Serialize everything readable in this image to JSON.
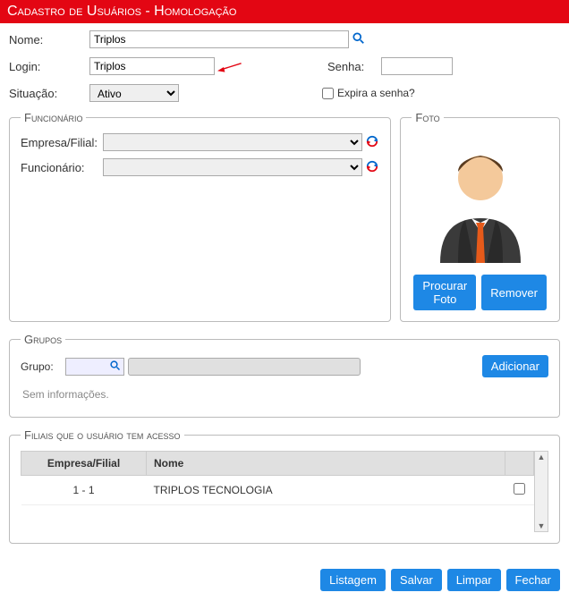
{
  "header": {
    "title": "Cadastro de Usuários  - Homologação"
  },
  "form": {
    "nome_label": "Nome:",
    "nome_value": "Triplos",
    "login_label": "Login:",
    "login_value": "Triplos",
    "senha_label": "Senha:",
    "senha_value": "",
    "situacao_label": "Situação:",
    "situacao_value": "Ativo",
    "expira_label": "Expira a senha?"
  },
  "funcionario": {
    "legend": "Funcionário",
    "empresa_label": "Empresa/Filial:",
    "empresa_value": "",
    "func_label": "Funcionário:",
    "func_value": ""
  },
  "foto": {
    "legend": "Foto",
    "procurar": "Procurar Foto",
    "remover": "Remover"
  },
  "grupos": {
    "legend": "Grupos",
    "label": "Grupo:",
    "value": "",
    "adicionar": "Adicionar",
    "empty": "Sem informações."
  },
  "filiais": {
    "legend": "Filiais que o usuário tem acesso",
    "col_ef": "Empresa/Filial",
    "col_nome": "Nome",
    "rows": [
      {
        "ef": "1 - 1",
        "nome": "TRIPLOS TECNOLOGIA",
        "checked": false
      }
    ]
  },
  "footer": {
    "listagem": "Listagem",
    "salvar": "Salvar",
    "limpar": "Limpar",
    "fechar": "Fechar"
  }
}
